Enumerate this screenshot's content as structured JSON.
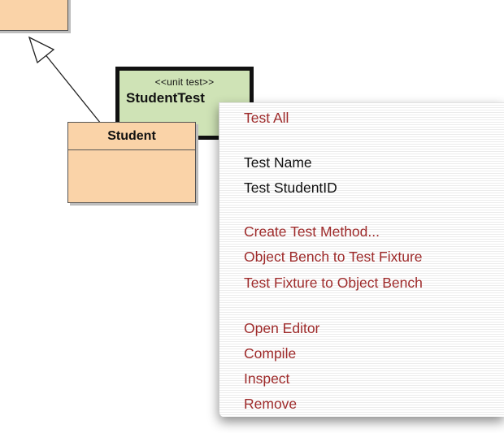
{
  "diagram": {
    "test_class": {
      "stereotype": "<<unit test>>",
      "name": "StudentTest"
    },
    "student_class": {
      "name": "Student"
    }
  },
  "context_menu": {
    "group_run_all": [
      {
        "label": "Test All",
        "color": "#9e2a2a"
      }
    ],
    "group_test_methods": [
      {
        "label": "Test Name",
        "color": "#111111"
      },
      {
        "label": "Test StudentID",
        "color": "#111111"
      }
    ],
    "group_fixture": [
      {
        "label": "Create Test Method...",
        "color": "#9e2a2a"
      },
      {
        "label": "Object Bench to Test Fixture",
        "color": "#9e2a2a"
      },
      {
        "label": "Test Fixture to Object Bench",
        "color": "#9e2a2a"
      }
    ],
    "group_class_actions": [
      {
        "label": "Open Editor",
        "color": "#9e2a2a"
      },
      {
        "label": "Compile",
        "color": "#9e2a2a"
      },
      {
        "label": "Inspect",
        "color": "#9e2a2a"
      },
      {
        "label": "Remove",
        "color": "#9e2a2a"
      }
    ]
  }
}
